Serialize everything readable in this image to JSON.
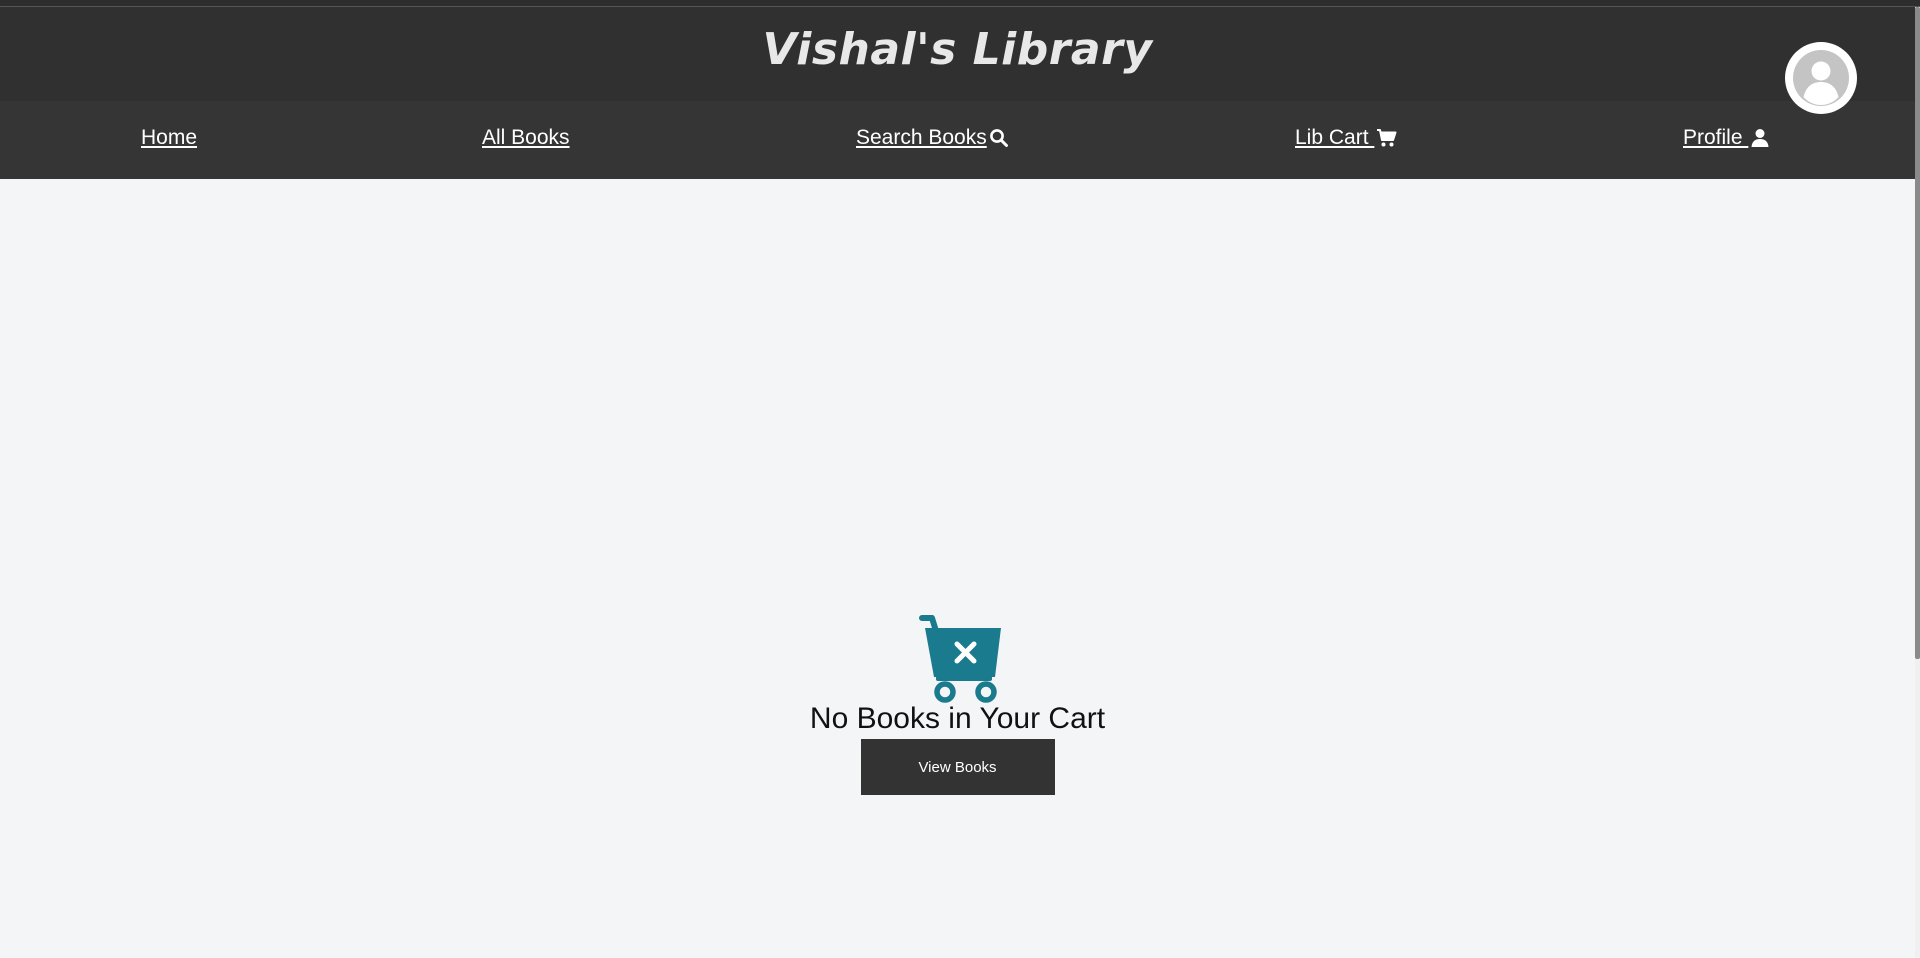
{
  "header": {
    "title": "Vishal's Library",
    "avatar_icon": "user-avatar-icon"
  },
  "nav": {
    "items": [
      {
        "label": "Home",
        "icon": null
      },
      {
        "label": "All Books",
        "icon": null
      },
      {
        "label": "Search Books",
        "icon": "search-icon"
      },
      {
        "label": "Lib Cart ",
        "icon": "cart-icon"
      },
      {
        "label": "Profile ",
        "icon": "user-icon"
      }
    ]
  },
  "main": {
    "empty_icon": "empty-cart-icon",
    "empty_message": "No Books in Your Cart",
    "view_button_label": "View Books"
  },
  "colors": {
    "header_bg": "#303030",
    "nav_bg": "#353535",
    "page_bg": "#f4f5f7",
    "accent": "#1b7b8e",
    "button_bg": "#333333"
  }
}
